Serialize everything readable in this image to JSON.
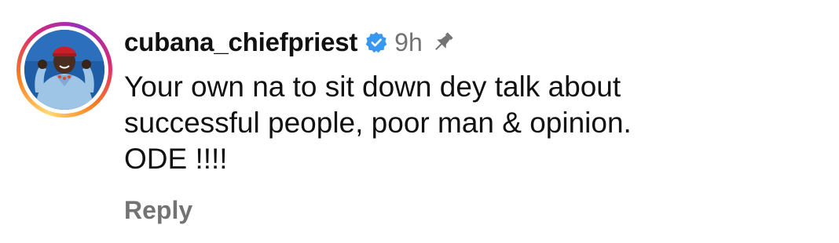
{
  "comment": {
    "username": "cubana_chiefpriest",
    "verified_icon": "verified-badge-icon",
    "verified_color": "#3897f0",
    "timestamp": "9h",
    "pin_icon": "pin-icon",
    "text_lines": [
      "Your own na to sit down dey talk about",
      "successful people, poor man & opinion.",
      "ODE !!!!"
    ],
    "reply_label": "Reply"
  },
  "colors": {
    "text": "#111111",
    "muted": "#737373",
    "story_ring": [
      "#feda75",
      "#fa7e1e",
      "#d62976",
      "#962fbf"
    ]
  }
}
